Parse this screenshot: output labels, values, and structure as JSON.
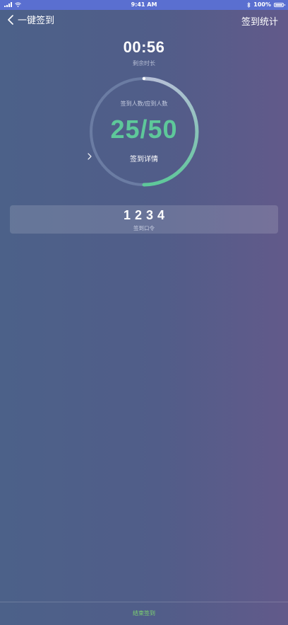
{
  "status_bar": {
    "time": "9:41 AM",
    "battery": "100%"
  },
  "nav": {
    "title": "一键签到",
    "right_action": "签到统计"
  },
  "countdown": {
    "time": "00:56",
    "label": "剩余时长"
  },
  "progress": {
    "caption": "签到人数/应到人数",
    "count_text": "25/50",
    "checked_in": 25,
    "expected": 50,
    "detail_label": "签到详情",
    "track_color": "#6b7ca3",
    "progress_start_color": "#b5bfd6",
    "progress_end_color": "#5ec89a",
    "count_color": "#5ec89a"
  },
  "password": {
    "code": "1234",
    "label": "签到口令"
  },
  "footer": {
    "end_label": "结束签到",
    "end_color": "#7ed56f"
  }
}
